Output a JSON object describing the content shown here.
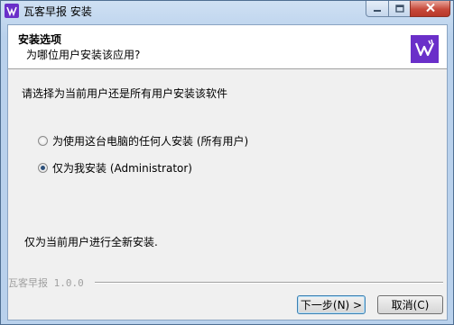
{
  "window": {
    "title": "瓦客早报 安装",
    "icons": {
      "app": "app-icon",
      "minimize": "minimize-icon",
      "maximize": "maximize-icon",
      "close": "close-icon"
    }
  },
  "header": {
    "title": "安装选项",
    "subtitle": "为哪位用户安装该应用?",
    "logo_icon": "installer-logo-icon",
    "logo_color": "#6a2fc9"
  },
  "main": {
    "prompt": "请选择为当前用户还是所有用户安装该软件",
    "options": [
      {
        "label": "为使用这台电脑的任何人安装 (所有用户)",
        "checked": false
      },
      {
        "label": "仅为我安装 (Administrator)",
        "checked": true
      }
    ],
    "note": "仅为当前用户进行全新安装."
  },
  "footer": {
    "brand": "瓦客早报 1.0.0",
    "next_label": "下一步(N) >",
    "cancel_label": "取消(C)"
  }
}
